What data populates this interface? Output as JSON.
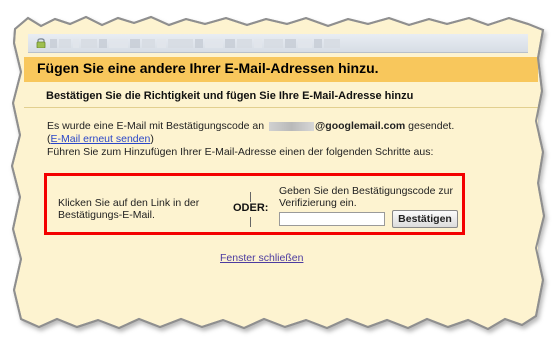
{
  "window": {
    "blurred_url_segments": [
      "",
      "",
      "",
      "",
      "",
      "",
      "",
      "",
      "",
      "",
      "",
      "",
      "",
      "",
      "",
      "",
      "",
      "",
      "",
      ""
    ]
  },
  "dialog": {
    "title": "Fügen Sie eine andere Ihrer E-Mail-Adressen hinzu.",
    "subtitle": "Bestätigen Sie die Richtigkeit und fügen Sie Ihre E-Mail-Adresse hinzu",
    "message": {
      "prefix": "Es wurde eine E-Mail mit Bestätigungscode an",
      "redacted_email": "",
      "domain": "@googlemail.com",
      "suffix": "gesendet.",
      "resend_open_paren": "(",
      "resend_link": "E-Mail erneut senden",
      "resend_close_paren": ")",
      "instruction": "Führen Sie zum Hinzufügen Ihrer E-Mail-Adresse einen der folgenden Schritte aus:"
    },
    "options": {
      "left_text": "Klicken Sie auf den Link in der Bestätigungs-E-Mail.",
      "divider_label": "ODER:",
      "right_text": "Geben Sie den Bestätigungscode zur Verifizierung ein.",
      "code_input": {
        "value": "",
        "placeholder": ""
      },
      "confirm_button": "Bestätigen"
    },
    "close_link": "Fenster schließen"
  },
  "colors": {
    "title_band": "#f8c75c",
    "content_background": "#fdf3d0",
    "highlight_border": "#f30000",
    "link_blue": "#2a46c8",
    "close_link_purple": "#4c3ba0"
  },
  "icons": {
    "lock": "lock-icon"
  }
}
